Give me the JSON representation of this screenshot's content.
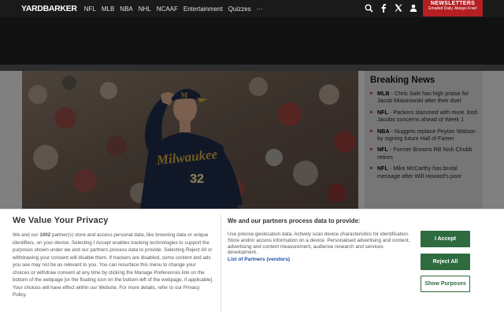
{
  "nav": {
    "logo": "YARDBARKER",
    "links": [
      "NFL",
      "MLB",
      "NBA",
      "NHL",
      "NCAAF",
      "Entertainment",
      "Quizzes",
      "···"
    ],
    "icons": [
      "search-icon",
      "facebook-icon",
      "x-icon",
      "user-icon"
    ],
    "newsletter_title": "NEWSLETTERS",
    "newsletter_sub": "Emailed Daily. Always Free!"
  },
  "sidebar": {
    "title": "Breaking News",
    "items": [
      {
        "tag": "MLB",
        "text": " - Chris Sale has high praise for Jacob Misiorowski after their duel"
      },
      {
        "tag": "NFL",
        "text": " - Packers slammed with more Josh Jacobs concerns ahead of Week 1"
      },
      {
        "tag": "NBA",
        "text": " - Nuggets replace Peyton Watson by signing future Hall of Famer"
      },
      {
        "tag": "NFL",
        "text": " - Former Browns RB Nick Chubb retires"
      },
      {
        "tag": "NFL",
        "text": " - Mike McCarthy has brutal message after Will Howard's poor"
      }
    ]
  },
  "hero": {
    "jersey_text": "Milwaukee",
    "jersey_number": "32"
  },
  "privacy": {
    "title": "We Value Your Privacy",
    "body_pre": "We and our ",
    "partner_count": "1002",
    "body_post": " partner(s) store and access personal data, like browsing data or unique identifiers, on your device. Selecting I Accept enables tracking technologies to support the purposes shown under we and our partners process data to provide. Selecting Reject All or withdrawing your consent will disable them. If trackers are disabled, some content and ads you see may not be as relevant to you. You can resurface this menu to change your choices or withdraw consent at any time by clicking the Manage Preferences link on the bottom of the webpage [or the floating icon on the bottom-left of the webpage, if applicable]. Your choices will have effect within our Website. For more details, refer to our Privacy Policy.",
    "purposes_title": "We and our partners process data to provide:",
    "purposes_text": "Use precise geolocation data. Actively scan device characteristics for identification. Store and/or access information on a device. Personalised advertising and content, advertising and content measurement, audience research and services development.",
    "partners_link": "List of Partners (vendors)",
    "accept_label": "I Accept",
    "reject_label": "Reject All",
    "show_purposes_label": "Show Purposes"
  },
  "colors": {
    "accent_red": "#b51f24",
    "button_green": "#2e6b3f",
    "nav_bg": "#1a1a1a"
  }
}
